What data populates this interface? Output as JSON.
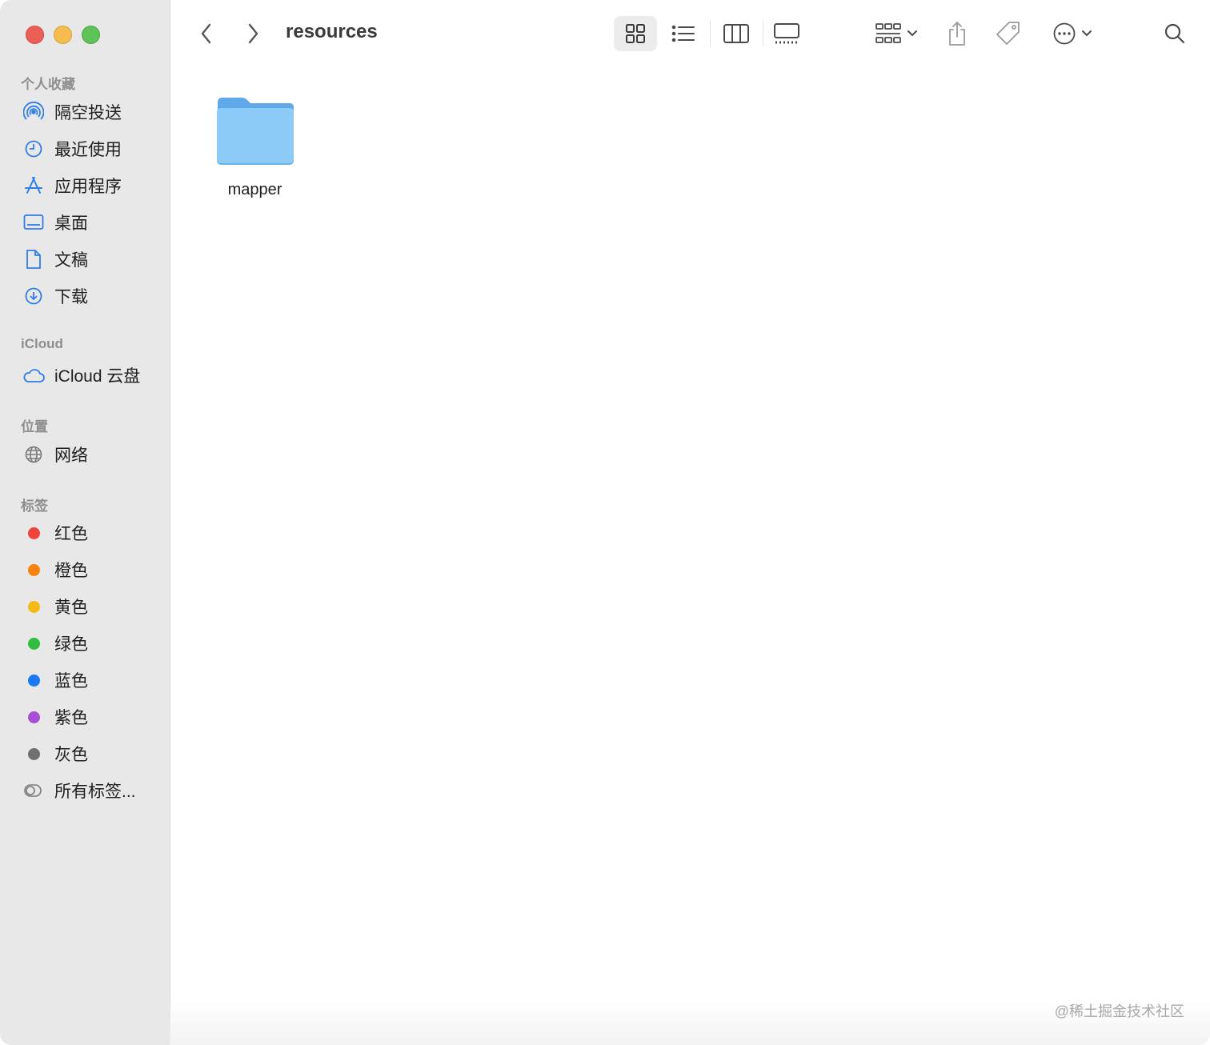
{
  "window": {
    "title": "resources"
  },
  "sidebar": {
    "favorites_title": "个人收藏",
    "favorites": [
      {
        "label": "隔空投送",
        "icon": "airdrop-icon"
      },
      {
        "label": "最近使用",
        "icon": "clock-icon"
      },
      {
        "label": "应用程序",
        "icon": "apps-icon"
      },
      {
        "label": "桌面",
        "icon": "desktop-icon"
      },
      {
        "label": "文稿",
        "icon": "document-icon"
      },
      {
        "label": "下载",
        "icon": "download-icon"
      }
    ],
    "icloud_title": "iCloud",
    "icloud": [
      {
        "label": "iCloud 云盘",
        "icon": "cloud-icon"
      }
    ],
    "locations_title": "位置",
    "locations": [
      {
        "label": "网络",
        "icon": "globe-icon"
      }
    ],
    "tags_title": "标签",
    "tags": [
      {
        "label": "红色",
        "color": "#f0443a"
      },
      {
        "label": "橙色",
        "color": "#f5830c"
      },
      {
        "label": "黄色",
        "color": "#f4bb18"
      },
      {
        "label": "绿色",
        "color": "#2fbe3f"
      },
      {
        "label": "蓝色",
        "color": "#1a78f2"
      },
      {
        "label": "紫色",
        "color": "#a64ed6"
      },
      {
        "label": "灰色",
        "color": "#707070"
      }
    ],
    "all_tags": "所有标签..."
  },
  "content": {
    "items": [
      {
        "label": "mapper",
        "type": "folder"
      }
    ]
  },
  "watermark": "@稀土掘金技术社区"
}
